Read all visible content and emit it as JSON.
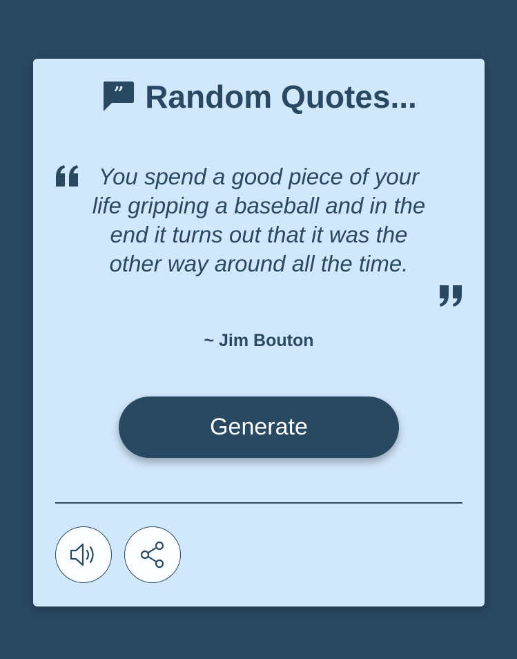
{
  "header": {
    "title": "Random Quotes...",
    "icon": "speech-bubble-quote-icon"
  },
  "quote": {
    "text": "You spend a good piece of your life gripping a baseball and in the end it turns out that it was the other way around all the time.",
    "author": "~ Jim Bouton"
  },
  "actions": {
    "generate_label": "Generate",
    "speak_icon": "speaker-icon",
    "share_icon": "share-icon"
  },
  "colors": {
    "background": "#294862",
    "card": "#d1e7fc",
    "accent": "#294862",
    "button_text": "#ffffff"
  }
}
